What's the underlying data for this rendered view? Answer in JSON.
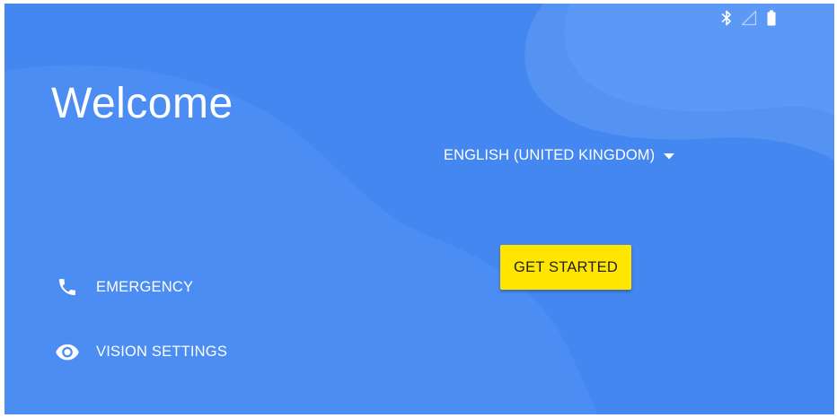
{
  "welcome": {
    "title": "Welcome"
  },
  "language": {
    "selected": "ENGLISH (UNITED KINGDOM)",
    "icon": "dropdown-arrow"
  },
  "primary_action": {
    "label": "GET STARTED",
    "color": "#ffe500"
  },
  "secondary_actions": [
    {
      "label": "EMERGENCY",
      "icon": "phone"
    },
    {
      "label": "VISION SETTINGS",
      "icon": "eye"
    }
  ],
  "status_bar": {
    "icons": [
      "bluetooth",
      "cellular-no-signal",
      "battery-full"
    ]
  },
  "theme": {
    "background": "#4487f0",
    "text": "#ffffff"
  }
}
